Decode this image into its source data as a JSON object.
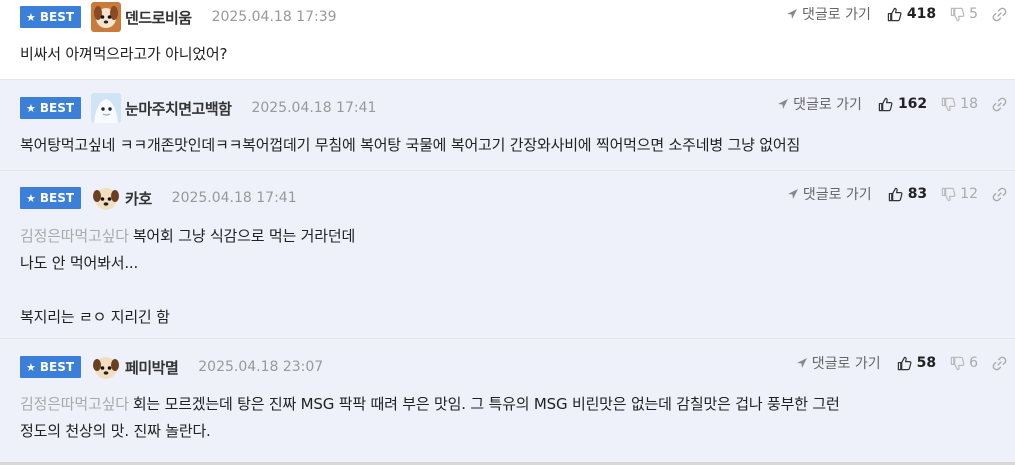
{
  "comments": [
    {
      "badge": "BEST",
      "nickname": "덴드로비움",
      "date": "2025.04.18 17:39",
      "reply_label": "댓글로 가기",
      "likes": "418",
      "dislikes": "5",
      "mention": "",
      "lines": [
        "비싸서 아껴먹으라고가 아니었어?"
      ]
    },
    {
      "badge": "BEST",
      "nickname": "눈마주치면고백함",
      "date": "2025.04.18 17:41",
      "reply_label": "댓글로 가기",
      "likes": "162",
      "dislikes": "18",
      "mention": "",
      "lines": [
        "복어탕먹고싶네 ㅋㅋ개존맛인데ㅋㅋ복어껍데기 무침에 복어탕 국물에 복어고기 간장와사비에 찍어먹으면 소주네병 그냥 없어짐"
      ]
    },
    {
      "badge": "BEST",
      "nickname": "카호",
      "date": "2025.04.18 17:41",
      "reply_label": "댓글로 가기",
      "likes": "83",
      "dislikes": "12",
      "mention": "김정은따먹고싶다",
      "lines": [
        "복어회 그냥 식감으로 먹는 거라던데",
        "나도 안 먹어봐서...",
        "",
        "복지리는 ㄹㅇ 지리긴 함"
      ]
    },
    {
      "badge": "BEST",
      "nickname": "페미박멸",
      "date": "2025.04.18 23:07",
      "reply_label": "댓글로 가기",
      "likes": "58",
      "dislikes": "6",
      "mention": "김정은따먹고싶다",
      "lines": [
        "회는 모르겠는데 탕은 진짜 MSG 팍팍 때려 부은 맛임. 그 특유의 MSG 비린맛은 없는데 감칠맛은 겁나 풍부한 그런",
        "정도의 천상의 맛. 진짜 놀란다."
      ]
    }
  ],
  "colors": {
    "badge": "#3c7fd8",
    "row_bg": "#eff1fa",
    "meta": "#999999",
    "mention": "#aaaaaa"
  },
  "icons": {
    "badge": "star-icon",
    "reply": "arrow-icon",
    "like": "thumbs-up-icon",
    "dislike": "thumbs-down-icon",
    "link": "link-icon"
  }
}
